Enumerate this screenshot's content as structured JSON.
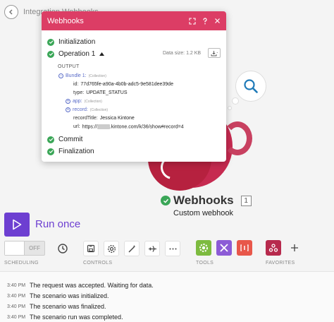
{
  "header": {
    "scenario_name": "Integration Webhooks"
  },
  "popup": {
    "title": "Webhooks",
    "steps": [
      {
        "label": "Initialization"
      },
      {
        "label": "Operation 1"
      },
      {
        "label": "Commit"
      },
      {
        "label": "Finalization"
      }
    ],
    "data_size": "Data size: 1.2 KB",
    "output_label": "OUTPUT",
    "bundle": {
      "key": "Bundle 1:",
      "tag": "(Collection)",
      "id_key": "id:",
      "id_value": "77d765fe-a90a-4b0b-adc5-9e581dee39de",
      "type_key": "type:",
      "type_value": "UPDATE_STATUS",
      "app_key": "app:",
      "app_tag": "(Collection)",
      "record_key": "record:",
      "record_tag": "(Collection)",
      "record_title_key": "recordTitle:",
      "record_title_value": "Jessica Kintone",
      "url_key": "url:",
      "url_prefix": "https://",
      "url_suffix": ".kintone.com/k/36/show#record=4"
    }
  },
  "module": {
    "title": "Webhooks",
    "count": "1",
    "subtitle": "Custom webhook"
  },
  "run": {
    "label": "Run once"
  },
  "toolbar": {
    "toggle_text": "OFF",
    "sections": {
      "scheduling": "SCHEDULING",
      "controls": "CONTROLS",
      "tools": "TOOLS",
      "favorites": "FAVORITES"
    }
  },
  "log": [
    {
      "time": "3:40 PM",
      "message": "The request was accepted. Waiting for data."
    },
    {
      "time": "3:40 PM",
      "message": "The scenario was initialized."
    },
    {
      "time": "3:40 PM",
      "message": "The scenario was finalized."
    },
    {
      "time": "3:40 PM",
      "message": "The scenario run was completed."
    }
  ],
  "colors": {
    "popup_header": "#dc3d65",
    "module": "#c62a50",
    "success": "#3aa657",
    "run_button": "#6d3fd1",
    "tool_green": "#7dbb3f",
    "tool_purple": "#8c5bd6",
    "tool_orange": "#e8574a",
    "favorite": "#b72a4d"
  }
}
